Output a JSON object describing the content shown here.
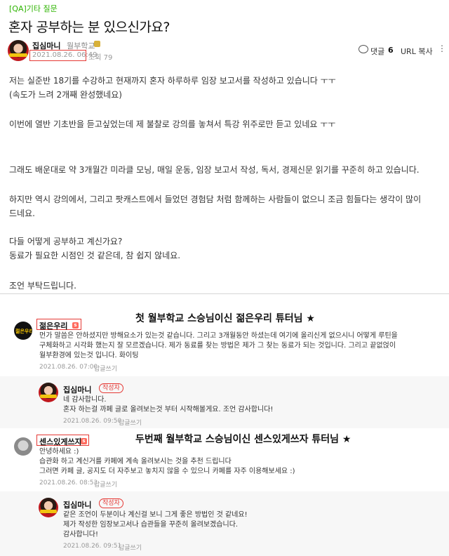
{
  "post": {
    "category": "[QA]기타 질문",
    "title": "혼자 공부하는 분 있으신가요?",
    "author": "집심마니",
    "level": "월부학교",
    "date": "2021.08.26. 06:49",
    "views": "조회 79",
    "comment_label": "댓글",
    "comment_count": "6",
    "url_copy": "URL 복사",
    "more_icon": "⋮",
    "body": [
      "저는 실준반 18기를 수강하고 현재까지 혼자 하루하루 임장 보고서를 작성하고 있습니다 ㅜㅜ",
      "(속도가 느려 2개째 완성했네요)",
      "이번에 열반 기초반을 듣고싶었는데 제 불찰로 강의를 놓쳐서 특강 위주로만 듣고 있네요 ㅜㅜ",
      "그래도 배운대로 약 3개월간 미라클 모닝, 매일 운동, 임장 보고서 작성, 독서, 경제신문 읽기를 꾸준히 하고 있습니다.",
      "하지만 역시 강의에서, 그리고 팟캐스트에서 들었던 경험담 처럼 함께하는 사람들이 없으니 조금 힘들다는 생각이 많이",
      "드네요.",
      "다들 어떻게 공부하고 계신가요?",
      "동료가 필요한 시점인 것 같은데, 참 쉽지 않네요.",
      "조언 부탁드립니다."
    ]
  },
  "annotations": {
    "first": "첫 월부학교 스승님이신 젊은우리 튜터님 ★",
    "second": "두번째 월부학교 스승님이신 센스있게쓰자 튜터님 ★"
  },
  "comments": [
    {
      "author": "젊은우리",
      "avatar_text": "젊은우리",
      "badge": "s",
      "lines": [
        "먼가 말씀은 안하셨지만 방해요소가 있는것 같습니다. 그리고 3개월동안 하셨는데 여기에 올리신게 없으시니 어떻게 루틴을",
        "구체화하고 시각화 했는지 잘 모르겠습니다. 제가 동료를 찾는 방법은 제가 그 찾는 동료가 되는 것입니다. 그리고 끝없얹이",
        "월부환경에 있는것 입니다. 화이팅"
      ],
      "date": "2021.08.26. 07:00",
      "reply": "답글쓰기"
    },
    {
      "author": "집심마니",
      "writer_badge": "작성자",
      "lines": [
        "네 감사합니다.",
        "혼자 하는걸 까페 글로 올려보는것 부터 시작해볼게요. 조언 감사합니다!"
      ],
      "date": "2021.08.26. 09:50",
      "reply": "답글쓰기"
    },
    {
      "author": "센스있게쓰자",
      "badge": "s",
      "lines": [
        "안녕하세요 :)",
        "습관화 하고 계신거를 카페에 계속 올려보시는 것을 추천 드립니다",
        "그러면 카페 글, 공지도 더 자주보고 놓치지 않을 수 있으니 카페를 자주 이용해보세요 :)"
      ],
      "date": "2021.08.26. 08:53",
      "reply": "답글쓰기"
    },
    {
      "author": "집심마니",
      "writer_badge": "작성자",
      "lines": [
        "같은 조언이 두분이나 계신걸 보니 그게 좋은 방법인 것 같네요!",
        "제가 작성한 임장보고서나 습관들을 꾸준히 올려보겠습니다.",
        "감사합니다!"
      ],
      "date": "2021.08.26. 09:51",
      "reply": "답글쓰기"
    }
  ],
  "colors": {
    "accent_green": "#2db400",
    "highlight_red": "#e53935"
  }
}
